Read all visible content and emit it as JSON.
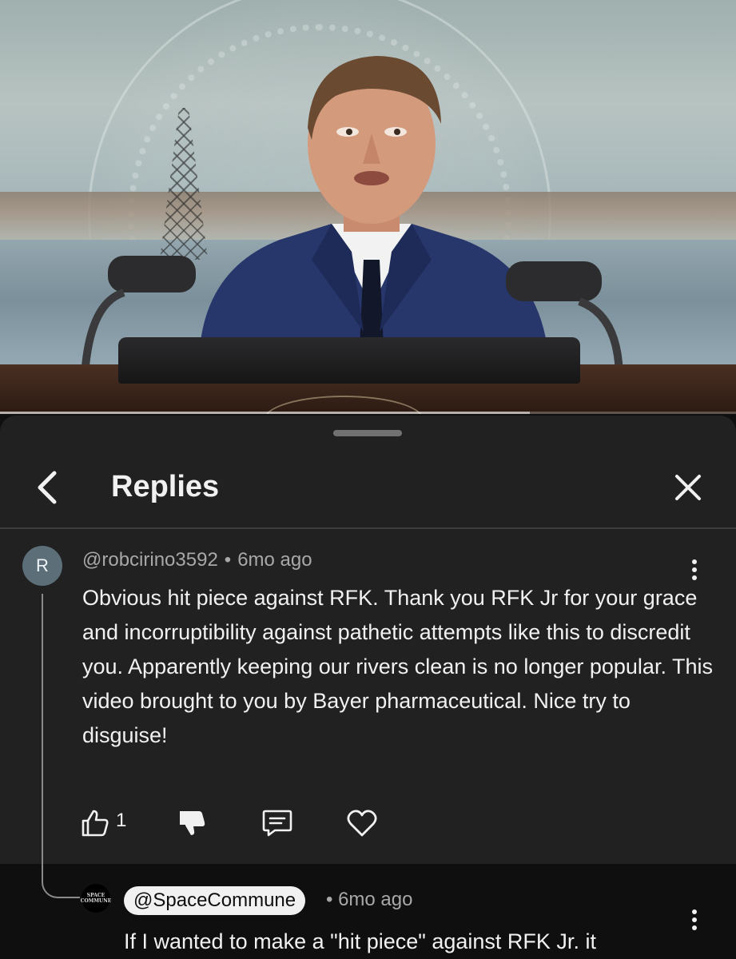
{
  "video": {
    "progress": 0.72
  },
  "sheet": {
    "title": "Replies",
    "back_icon": "chevron-left-icon",
    "close_icon": "close-icon"
  },
  "comment": {
    "avatar_letter": "R",
    "author": "@robcirino3592",
    "separator": "•",
    "time": "6mo ago",
    "text": "Obvious hit piece against RFK.  Thank you RFK Jr for your grace and incorruptibility against pathetic attempts like this to discredit you.  Apparently keeping our rivers clean is no longer popular.  This video brought to you by Bayer pharmaceutical.  Nice try to disguise!",
    "like_count": "1"
  },
  "reply": {
    "avatar_text": "SPACE COMMUNE",
    "author": "@SpaceCommune",
    "separator": "•",
    "time": "6mo ago",
    "text": "If I wanted to make a \"hit piece\" against RFK Jr. it"
  },
  "colors": {
    "sheet_bg": "#212121",
    "reply_bg": "#0f0f0f",
    "text": "#f1f1f1",
    "muted": "#a8a8a8",
    "avatar_r": "#5c6f78"
  }
}
